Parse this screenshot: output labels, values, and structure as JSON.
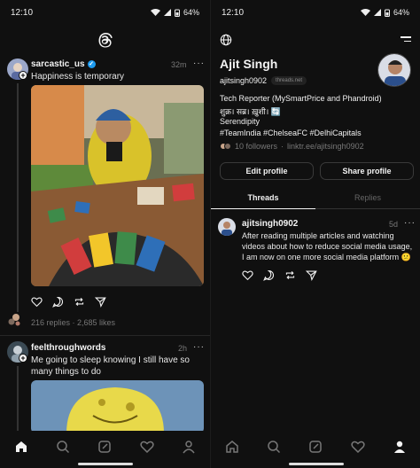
{
  "left": {
    "status": {
      "time": "12:10",
      "battery": "64%"
    },
    "posts": [
      {
        "username": "sarcastic_us",
        "time": "32m",
        "more": "···",
        "text": "Happiness is temporary",
        "stats": "216 replies · 2,685 likes"
      },
      {
        "username": "feelthroughwords",
        "time": "2h",
        "more": "···",
        "text": "Me going to sleep knowing I still have so many things to do"
      }
    ],
    "nav": [
      "home",
      "search",
      "compose",
      "activity",
      "profile"
    ]
  },
  "right": {
    "status": {
      "time": "12:10",
      "battery": "64%"
    },
    "profile": {
      "name": "Ajit Singh",
      "handle": "ajitsingh0902",
      "badge": "threads.net",
      "bio": [
        "Tech Reporter (MySmartPrice and Phandroid)",
        "शुक्र। सब्र। ख़ुशी। 🔄",
        "Serendipity",
        "#TeamIndia #ChelseaFC #DelhiCapitals"
      ],
      "followers": "10 followers",
      "link": "linktr.ee/ajitsingh0902",
      "edit_label": "Edit profile",
      "share_label": "Share profile"
    },
    "tabs": {
      "threads": "Threads",
      "replies": "Replies"
    },
    "post": {
      "username": "ajitsingh0902",
      "time": "5d",
      "more": "···",
      "text": "After reading multiple articles and watching videos about how to reduce social media usage, I am now on one more social media platform 😕"
    },
    "nav": [
      "home",
      "search",
      "compose",
      "activity",
      "profile"
    ]
  },
  "colors": {
    "background": "#101010",
    "accent": "#1d9bf0",
    "muted": "#777777"
  }
}
